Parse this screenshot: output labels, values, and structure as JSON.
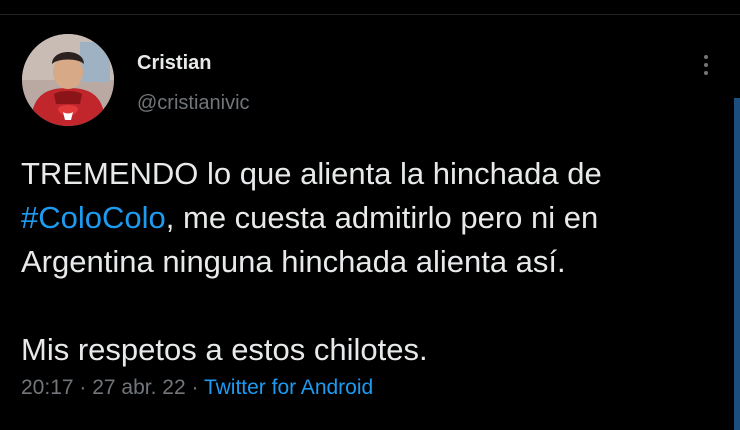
{
  "author": {
    "name": "Cristian",
    "handle": "@cristianivic"
  },
  "tweet": {
    "line1": "TREMENDO lo que alienta la hinchada de",
    "hashtag": "#ColoColo",
    "line2_rest": ", me cuesta admitirlo pero ni en",
    "line3": "Argentina ninguna hinchada alienta así.",
    "line4": "Mis respetos a estos chilotes."
  },
  "meta": {
    "time": "20:17",
    "separator1": " · ",
    "date": "27 abr. 22",
    "separator2": " · ",
    "source": "Twitter for Android"
  },
  "icons": {
    "more": "more-vertical-icon"
  },
  "colors": {
    "background": "#000000",
    "text": "#e7e9ea",
    "secondary": "#71767b",
    "link": "#1d9bf0"
  }
}
